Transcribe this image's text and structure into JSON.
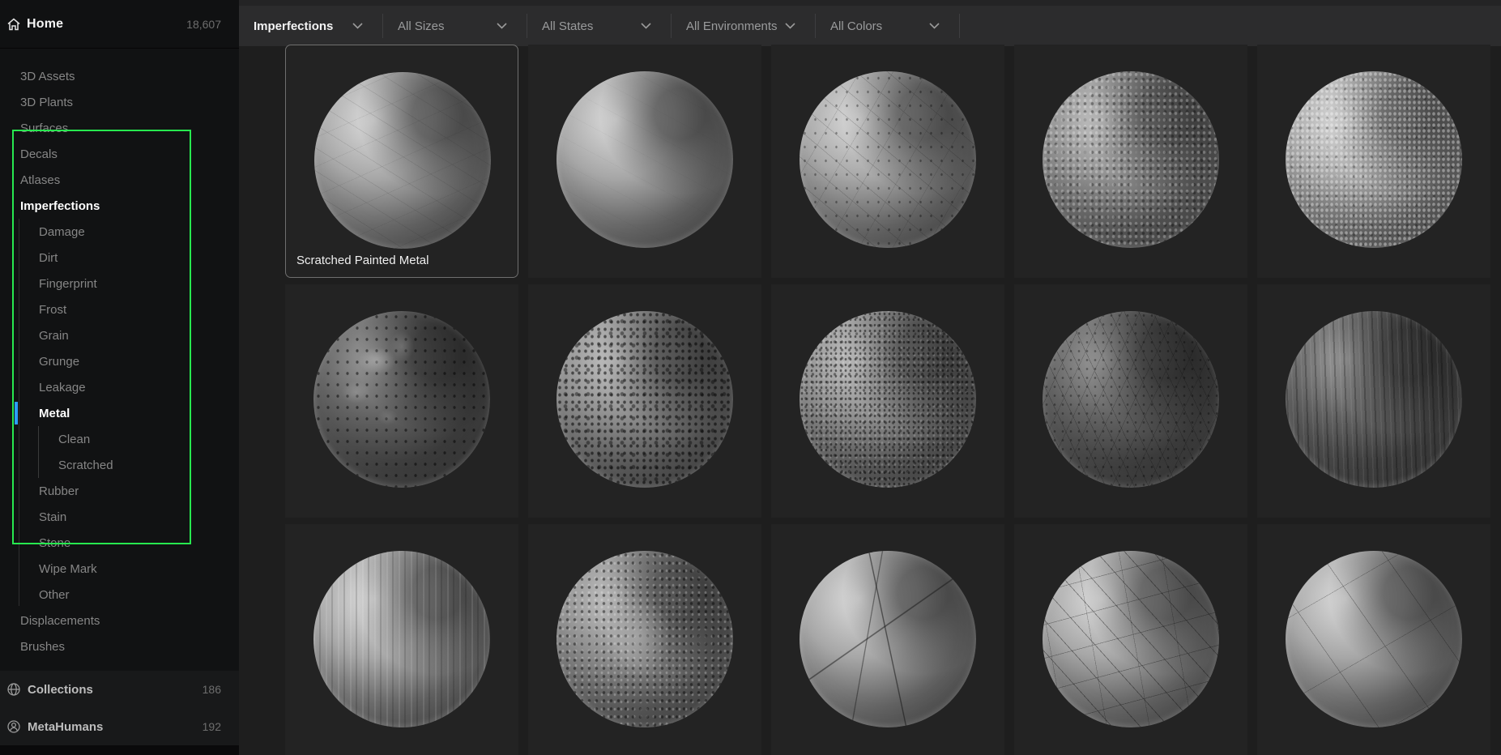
{
  "sidebar": {
    "home": {
      "icon": "home-icon",
      "label": "Home",
      "count": "18,607"
    },
    "items": [
      {
        "label": "3D Assets",
        "level": 0
      },
      {
        "label": "3D Plants",
        "level": 0
      },
      {
        "label": "Surfaces",
        "level": 0
      },
      {
        "label": "Decals",
        "level": 0
      },
      {
        "label": "Atlases",
        "level": 0
      },
      {
        "label": "Imperfections",
        "level": 0,
        "active": true
      },
      {
        "label": "Damage",
        "level": 1
      },
      {
        "label": "Dirt",
        "level": 1
      },
      {
        "label": "Fingerprint",
        "level": 1
      },
      {
        "label": "Frost",
        "level": 1
      },
      {
        "label": "Grain",
        "level": 1
      },
      {
        "label": "Grunge",
        "level": 1
      },
      {
        "label": "Leakage",
        "level": 1
      },
      {
        "label": "Metal",
        "level": 1,
        "selected": true
      },
      {
        "label": "Clean",
        "level": 2
      },
      {
        "label": "Scratched",
        "level": 2
      },
      {
        "label": "Rubber",
        "level": 1
      },
      {
        "label": "Stain",
        "level": 1
      },
      {
        "label": "Stone",
        "level": 1
      },
      {
        "label": "Wipe Mark",
        "level": 1
      },
      {
        "label": "Other",
        "level": 1
      },
      {
        "label": "Displacements",
        "level": 0
      },
      {
        "label": "Brushes",
        "level": 0
      }
    ],
    "bottom": [
      {
        "icon": "globe-icon",
        "label": "Collections",
        "count": "186"
      },
      {
        "icon": "person-icon",
        "label": "MetaHumans",
        "count": "192"
      }
    ]
  },
  "filterbar": {
    "filters": [
      {
        "label": "Imperfections",
        "icon": "chevron-down-icon",
        "active": true
      },
      {
        "label": "All Sizes",
        "icon": "chevron-down-icon"
      },
      {
        "label": "All States",
        "icon": "chevron-down-icon"
      },
      {
        "label": "All Environments",
        "icon": "chevron-down-icon"
      },
      {
        "label": "All Colors",
        "icon": "chevron-down-icon"
      }
    ]
  },
  "grid": {
    "tiles": [
      {
        "variant": "scratch-light",
        "label": "Scratched Painted Metal",
        "selected": true
      },
      {
        "variant": "smooth-light"
      },
      {
        "variant": "scratch-specks"
      },
      {
        "variant": "mottle-mid"
      },
      {
        "variant": "mottle-light"
      },
      {
        "variant": "flaky-dark"
      },
      {
        "variant": "speckle-mid"
      },
      {
        "variant": "speckle-dense"
      },
      {
        "variant": "hatch-dark"
      },
      {
        "variant": "streak-dark"
      },
      {
        "variant": "streak-light"
      },
      {
        "variant": "grunge-mid"
      },
      {
        "variant": "lines-light"
      },
      {
        "variant": "heavy-lines"
      },
      {
        "variant": "lines-sparse"
      }
    ]
  },
  "colors": {
    "highlight_green": "#27e84f",
    "accent_blue": "#2b9fff",
    "selection_border": "#6f6f6f",
    "sidebar_bg": "#111213",
    "topbar_bg": "#2c2c2d",
    "content_bg": "#1e1e1e",
    "tile_bg": "#232323"
  }
}
